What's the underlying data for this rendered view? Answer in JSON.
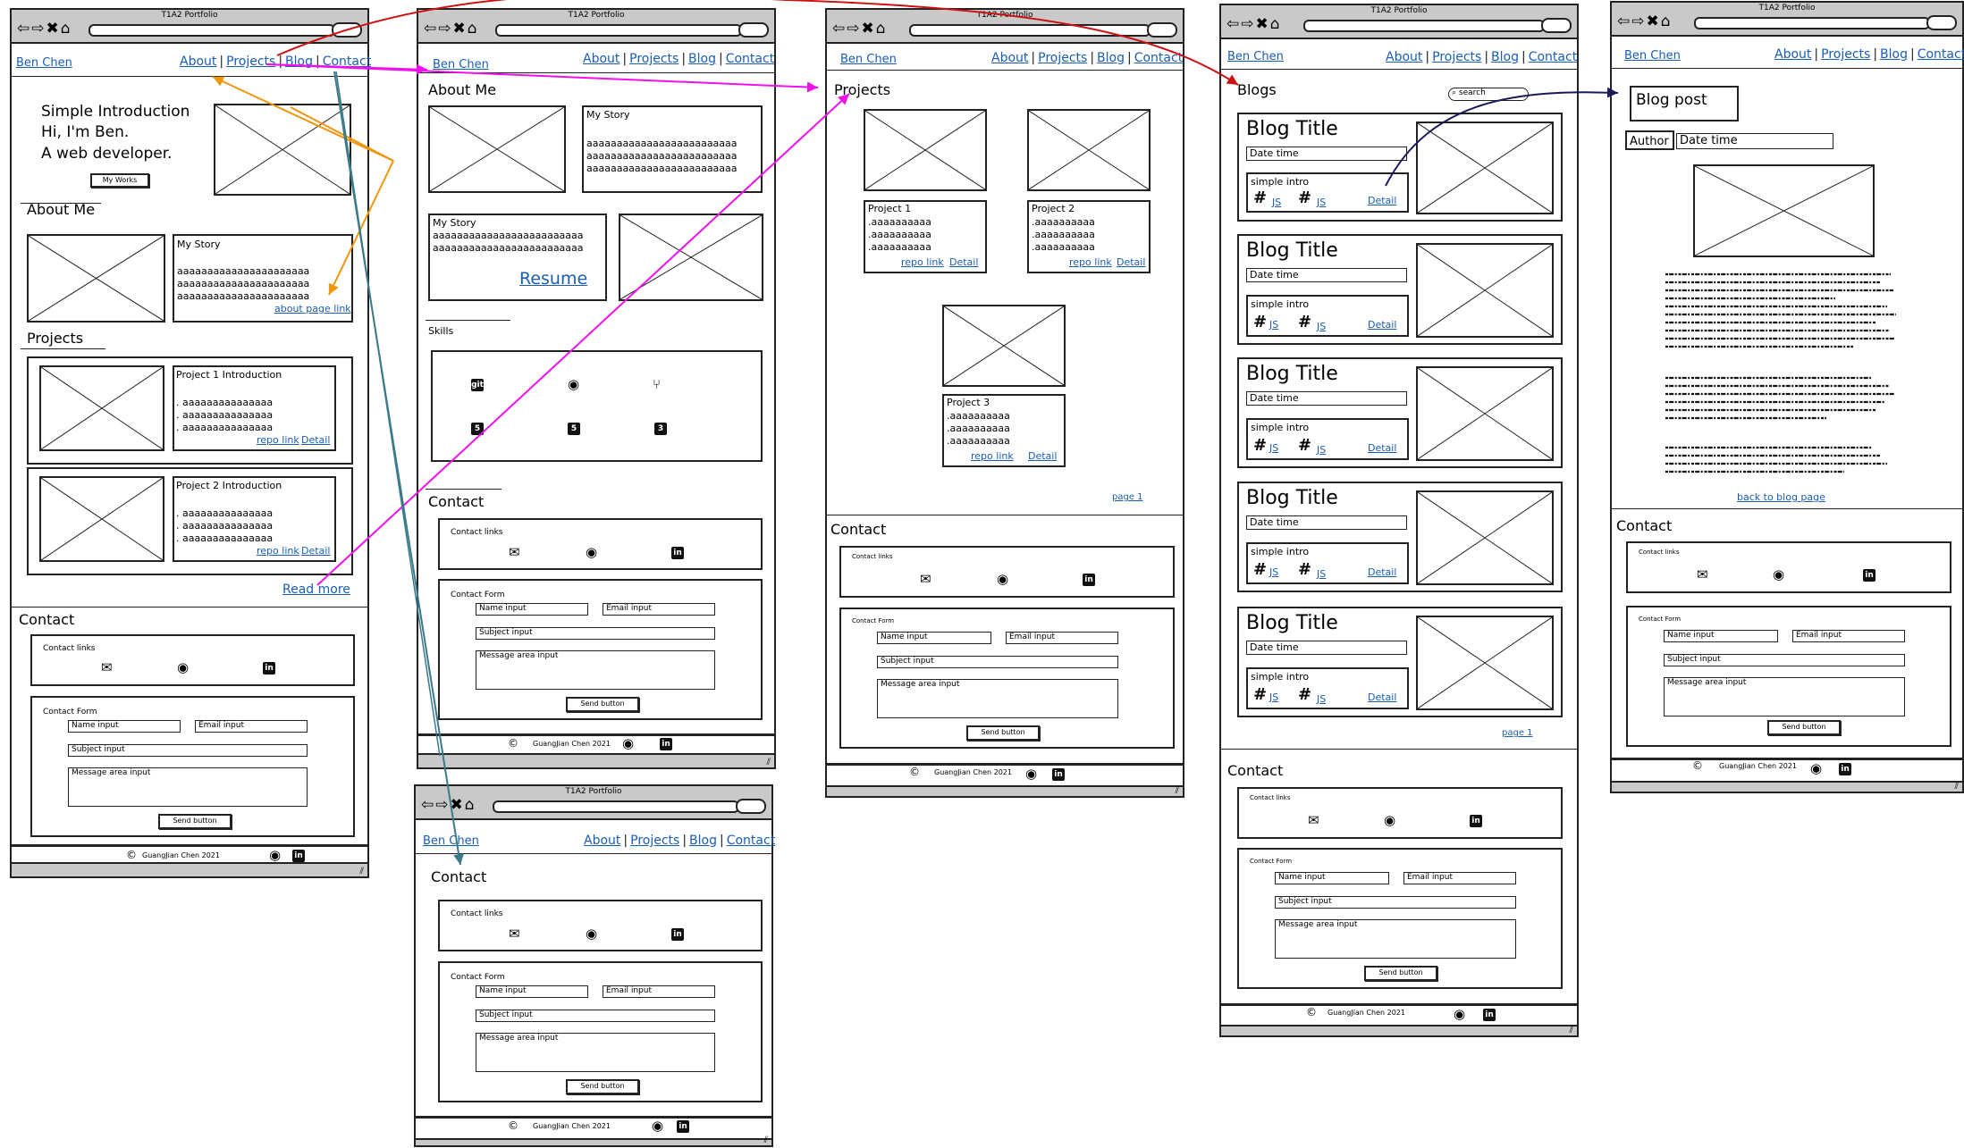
{
  "window_title": "T1A2 Portfolio",
  "brand": "Ben Chen",
  "nav": {
    "about": "About",
    "projects": "Projects",
    "blog": "Blog",
    "contact": "Contact"
  },
  "home": {
    "intro_line1": "Simple Introduction",
    "intro_line2": "Hi, I'm  Ben.",
    "intro_line3": "A web developer.",
    "works_button": "My Works",
    "about_heading": "About Me",
    "my_story": "My Story",
    "story_text": "aaaaaaaaaaaaaaaaaaaaaa",
    "about_page_link": "about page link",
    "projects_heading": "Projects",
    "project1_title": "Project 1 Introduction",
    "project2_title": "Project 2 Introduction",
    "project_text": ". aaaaaaaaaaaaaaa",
    "repo_link": "repo link",
    "detail": "Detail",
    "read_more": "Read more"
  },
  "about": {
    "heading": "About Me",
    "my_story": "My Story",
    "story_text": "aaaaaaaaaaaaaaaaaaaaaaaaa",
    "resume": "Resume",
    "skills": "Skills",
    "skill_icons": [
      "git-icon",
      "github-icon",
      "git-branch-icon",
      "html5-icon",
      "html5-icon",
      "css3-icon"
    ]
  },
  "contact": {
    "heading": "Contact",
    "links_label": "Contact links",
    "form_label": "Contact Form",
    "name_input": "Name input",
    "email_input": "Email input",
    "subject_input": "Subject input",
    "message_input": "Message area input",
    "send_button": "Send button",
    "footer": "GuangJian Chen 2021",
    "copyright": "©"
  },
  "projects": {
    "heading": "Projects",
    "items": [
      {
        "title": "Project 1",
        "line": ".aaaaaaaaaa"
      },
      {
        "title": "Project 2",
        "line": ".aaaaaaaaaa"
      },
      {
        "title": "Project 3",
        "line": ".aaaaaaaaaa"
      }
    ],
    "repo_link": "repo link",
    "detail": "Detail",
    "page": "page 1"
  },
  "blogs": {
    "heading": "Blogs",
    "search_placeholder": "search",
    "blog_title": "Blog Title",
    "date_time": "Date time",
    "simple_intro": "simple intro",
    "tag_hash": "#",
    "tag_js": "JS",
    "detail": "Detail",
    "page": "page 1"
  },
  "post": {
    "heading": "Blog post",
    "author": "Author",
    "date_time": "Date time",
    "back": "back to blog page"
  },
  "colors": {
    "arrow_red": "#cc1111",
    "arrow_orange": "#f0960a",
    "arrow_magenta": "#ee11ee",
    "arrow_teal": "#3a7a8a",
    "arrow_navy": "#1a1a5a",
    "link": "#1a5db3"
  }
}
